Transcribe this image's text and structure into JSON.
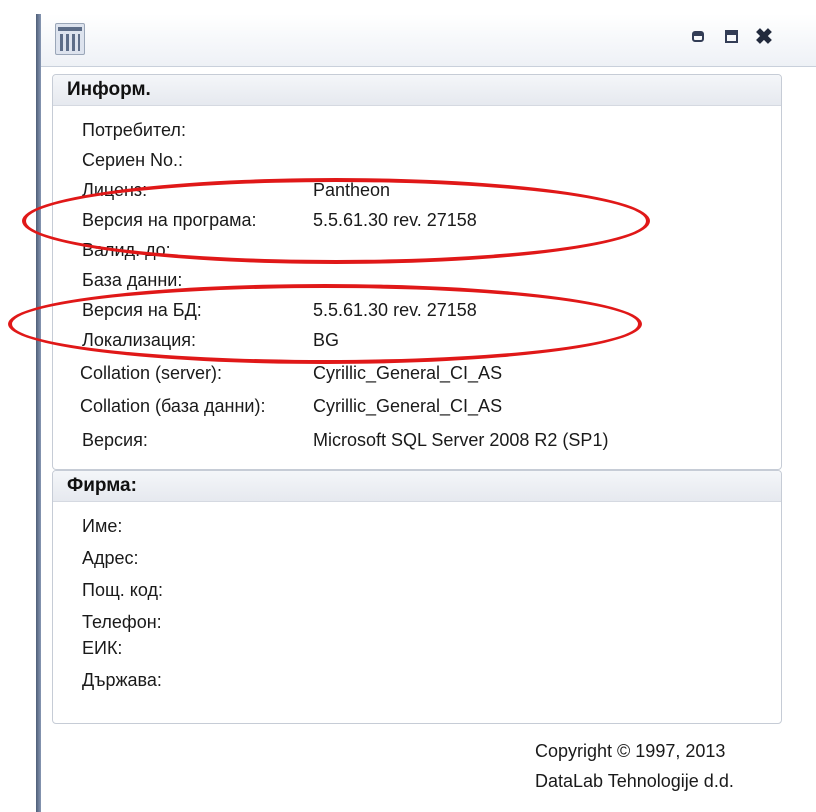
{
  "window": {
    "controls": {
      "minimize_icon": "minimize-icon",
      "maximize_icon": "maximize-icon",
      "close_label": "✖"
    },
    "app_icon": "database-icon",
    "accent_color": "#5d6d88"
  },
  "info": {
    "title": "Информ.",
    "rows": [
      {
        "label": "Потребител:",
        "value": ""
      },
      {
        "label": "Сериен No.:",
        "value": ""
      },
      {
        "label": "Лиценз:",
        "value": "Pantheon"
      },
      {
        "label": "Версия на програма:",
        "value": "5.5.61.30 rev. 27158"
      },
      {
        "label": "Валид. до:",
        "value": ""
      },
      {
        "label": "База данни:",
        "value": ""
      },
      {
        "label": "Версия на БД:",
        "value": "5.5.61.30 rev. 27158"
      },
      {
        "label": "Локализация:",
        "value": "BG"
      },
      {
        "label": "Collation (server):",
        "value": "Cyrillic_General_CI_AS"
      },
      {
        "label": "Collation (база данни):",
        "value": "Cyrillic_General_CI_AS"
      },
      {
        "label": "Версия:",
        "value": "Microsoft SQL Server 2008 R2 (SP1)"
      }
    ]
  },
  "firm": {
    "title": "Фирма:",
    "rows": [
      {
        "label": "Име:"
      },
      {
        "label": "Адрес:"
      },
      {
        "label": "Пощ. код:"
      },
      {
        "label": "Телефон:"
      },
      {
        "label": "ЕИК:"
      },
      {
        "label": "Държава:"
      }
    ]
  },
  "footer": {
    "copyright": "Copyright © 1997, 2013",
    "company": "DataLab Tehnologije d.d."
  },
  "annotations": {
    "ellipse_color": "#e01818"
  }
}
